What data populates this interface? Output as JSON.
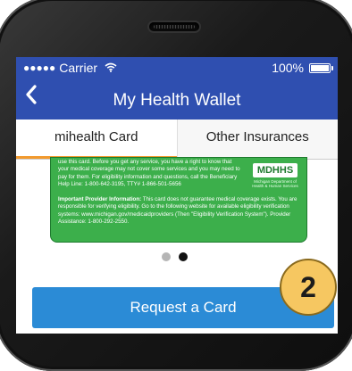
{
  "status_bar": {
    "signal": "●●●●●",
    "carrier": "Carrier",
    "wifi_icon": "wifi-icon",
    "battery_text": "100%",
    "battery_level": 1.0
  },
  "nav": {
    "back_icon": "chevron-left-icon",
    "title": "My Health Wallet"
  },
  "tabs": [
    {
      "label": "mihealth Card",
      "active": true
    },
    {
      "label": "Other Insurances",
      "active": false
    }
  ],
  "card": {
    "paragraph1": "use this card. Before you get any service, you have a right to know that your medical coverage may not cover some services and you may need to pay for them. For eligibility information and questions, call the Beneficiary Help Line: 1-800-642-3195, TTY# 1-866-501-5656",
    "provider_label": "Important Provider Information:",
    "provider_text": " This card does not guarantee medical coverage exists. You are responsible for verifying eligibility. Go to the following website for available eligibility verification systems: www.michigan.gov/medicaidproviders (Then \"Eligibility Verification System\"). Provider Assistance: 1-800-292-2550.",
    "logo_text": "MDHHS",
    "logo_sub": "Michigan Department of Health & Human Services",
    "background_color": "#3caf4b"
  },
  "pager": {
    "count": 2,
    "active_index": 1
  },
  "actions": {
    "request_label": "Request a Card"
  },
  "badge": {
    "label": "2"
  },
  "colors": {
    "nav_blue": "#2f4fb0",
    "button_blue": "#2b8bd6",
    "tab_indicator": "#f29a2e",
    "badge_gold": "#f6c761"
  }
}
